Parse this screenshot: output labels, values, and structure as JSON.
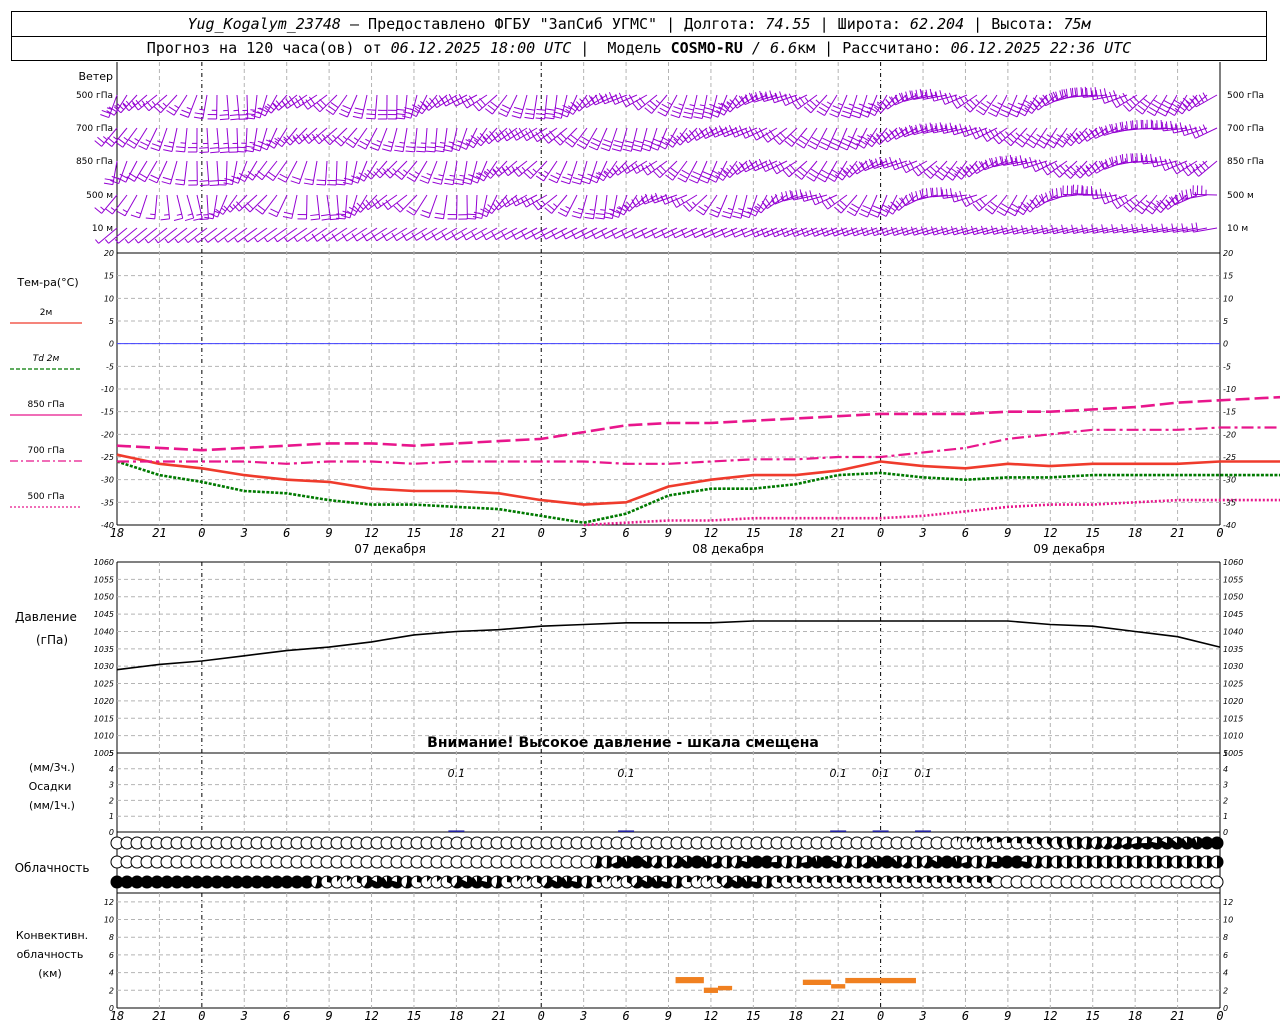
{
  "header": {
    "station": "Yug_Kogalym_23748",
    "provider": " — Предоставлено ФГБУ \"ЗапСиб УГМС\" ",
    "lon_label": " Долгота: ",
    "lon_value": "74.55",
    "lat_label": " Широта: ",
    "lat_value": "62.204",
    "alt_label": " Высота: ",
    "alt_value": "75м",
    "forecast_label": "Прогноз на 120 часа(ов) от ",
    "forecast_start": "06.12.2025 18:00 UTC",
    "model_label": "  Модель ",
    "model_name": "COSMO-RU",
    "model_res": " / 6.6",
    "model_res_unit": "км",
    "calc_label": " Рассчитано: ",
    "calc_time": "06.12.2025 22:36 UTC"
  },
  "wind_panel": {
    "title": "Ветер",
    "levels": [
      "500 гПа",
      "700 гПа",
      "850 гПа",
      "500 м",
      "10  м"
    ]
  },
  "temp_panel": {
    "title": "Тем-ра(°C)",
    "legend": [
      "2м",
      "Td  2м",
      "850 гПа",
      "700 гПа",
      "500 гПа"
    ]
  },
  "pressure_panel": {
    "title": "Давление",
    "unit": "(гПа)",
    "warning": "Внимание! Высокое давление - шкала смещена"
  },
  "precip_panel": {
    "unit3h": "(мм/3ч.)",
    "title": "Осадки",
    "unit1h": "(мм/1ч.)"
  },
  "cloud_panel": {
    "title": "Облачность"
  },
  "conv_panel": {
    "title1": "Конвективн.",
    "title2": "облачность",
    "unit": "(км)"
  },
  "time_axis": {
    "hour_labels": [
      "18",
      "21",
      "0",
      "3",
      "6",
      "9",
      "12",
      "15",
      "18",
      "21",
      "0",
      "3",
      "6",
      "9",
      "12",
      "15",
      "18",
      "21",
      "0",
      "3",
      "6",
      "9",
      "12",
      "15",
      "18",
      "21",
      "0"
    ],
    "day_labels": [
      "07 декабря",
      "08 декабря",
      "09 декабря"
    ]
  },
  "colors": {
    "wind": "#9400d3",
    "t2m": "#ef3b2c",
    "td2m": "#007a00",
    "upper": "#e8168c",
    "zero": "#3f3fff",
    "pressure": "#000000",
    "precip": "#1f1fa0",
    "convective": "#f08020"
  },
  "chart_data": [
    {
      "type": "line",
      "title": "Тем-ра(°C)",
      "x": [
        -6,
        -3,
        0,
        3,
        6,
        9,
        12,
        15,
        18,
        21,
        24,
        27,
        30,
        33,
        36,
        39,
        42,
        45,
        48,
        51,
        54,
        57,
        60,
        63,
        66,
        69,
        72,
        75,
        78,
        81,
        84,
        87,
        90
      ],
      "ylim": [
        -40,
        20
      ],
      "y_ticks": [
        20,
        15,
        10,
        5,
        0,
        -5,
        -10,
        -15,
        -20,
        -25,
        -30,
        -35,
        -40
      ],
      "grid": true,
      "series": [
        {
          "name": "2м",
          "values": [
            -24.5,
            -26.5,
            -27.5,
            -29,
            -30,
            -30.5,
            -32,
            -32.5,
            -32.5,
            -33,
            -34.5,
            -35.5,
            -35,
            -31.5,
            -30,
            -29,
            -29,
            -28,
            -26,
            -27,
            -27.5,
            -26.5,
            -27,
            -26.5,
            -26.5,
            -26.5,
            -26,
            -26,
            -26,
            -26,
            -26,
            -26,
            -25.5
          ]
        },
        {
          "name": "Td  2м",
          "values": [
            -26,
            -29,
            -30.5,
            -32.5,
            -33,
            -34.5,
            -35.5,
            -35.5,
            -36,
            -36.5,
            -38,
            -39.5,
            -37.5,
            -33.5,
            -32,
            -32,
            -31,
            -29,
            -28.5,
            -29.5,
            -30,
            -29.5,
            -29.5,
            -29,
            -29,
            -29,
            -29,
            -29,
            -29,
            -29,
            -29,
            -29,
            -29
          ]
        },
        {
          "name": "850 гПа",
          "values": [
            -22.5,
            -23,
            -23.5,
            -23,
            -22.5,
            -22,
            -22,
            -22.5,
            -22,
            -21.5,
            -21,
            -19.5,
            -18,
            -17.5,
            -17.5,
            -17,
            -16.5,
            -16,
            -15.5,
            -15.5,
            -15.5,
            -15,
            -15,
            -14.5,
            -14,
            -13,
            -12.5,
            -12,
            -11.5,
            -11.5,
            -11.5,
            -11.5,
            -11.5
          ]
        },
        {
          "name": "700 гПа",
          "values": [
            -26,
            -26,
            -26,
            -26,
            -26.5,
            -26,
            -26,
            -26.5,
            -26,
            -26,
            -26,
            -26,
            -26.5,
            -26.5,
            -26,
            -25.5,
            -25.5,
            -25,
            -25,
            -24,
            -23,
            -21,
            -20,
            -19,
            -19,
            -19,
            -18.5,
            -18.5,
            -18.5,
            -18.5,
            -18.5,
            -18.5,
            -18.5
          ]
        },
        {
          "name": "500 гПа",
          "values": [
            null,
            null,
            null,
            null,
            null,
            null,
            null,
            null,
            null,
            null,
            null,
            -40,
            -39.5,
            -39,
            -39,
            -38.5,
            -38.5,
            -38.5,
            -38.5,
            -38,
            -37,
            -36,
            -35.5,
            -35.5,
            -35,
            -34.5,
            -34.5,
            -34.5,
            -34.5,
            -34.5,
            -34.5,
            -34.5,
            -34.5
          ]
        }
      ]
    },
    {
      "type": "line",
      "title": "Давление",
      "ylabel": "(гПа)",
      "x": [
        -6,
        -3,
        0,
        3,
        6,
        9,
        12,
        15,
        18,
        21,
        24,
        27,
        30,
        33,
        36,
        39,
        42,
        45,
        48,
        51,
        54,
        57,
        60,
        63,
        66,
        69,
        72
      ],
      "ylim": [
        1005,
        1060
      ],
      "y_ticks": [
        1060,
        1055,
        1050,
        1045,
        1040,
        1035,
        1030,
        1025,
        1020,
        1015,
        1010,
        1005
      ],
      "series": [
        {
          "name": "",
          "values": [
            1029,
            1030.5,
            1031.5,
            1033,
            1034.5,
            1035.5,
            1037,
            1039,
            1040,
            1040.5,
            1041.5,
            1042,
            1042.5,
            1042.5,
            1042.5,
            1043,
            1043,
            1043,
            1043,
            1043,
            1043,
            1043,
            1042,
            1041.5,
            1040,
            1038.5,
            1035.5
          ]
        }
      ]
    },
    {
      "type": "bar",
      "title": "Осадки",
      "ylim": [
        0,
        5
      ],
      "y_ticks": [
        5,
        4,
        3,
        2,
        1,
        0
      ],
      "annotations": [
        {
          "x": 18,
          "text": "0.1"
        },
        {
          "x": 30,
          "text": "0.1"
        },
        {
          "x": 45,
          "text": "0.1"
        },
        {
          "x": 48,
          "text": "0.1"
        },
        {
          "x": 51,
          "text": "0.1"
        }
      ],
      "values": [
        {
          "x": 18,
          "y": 0.1
        },
        {
          "x": 30,
          "y": 0.1
        },
        {
          "x": 45,
          "y": 0.1
        },
        {
          "x": 48,
          "y": 0.1
        },
        {
          "x": 51,
          "y": 0.1
        }
      ]
    },
    {
      "type": "bar",
      "title": "Конвективн. облачность",
      "ylabel": "(км)",
      "ylim": [
        0,
        13
      ],
      "y_ticks": [
        12,
        10,
        8,
        6,
        4,
        2,
        0
      ],
      "values": [
        {
          "x_start": 33.5,
          "x_end": 35.5,
          "base": 2.8,
          "top": 3.5
        },
        {
          "x_start": 35.5,
          "x_end": 36.5,
          "base": 1.7,
          "top": 2.3
        },
        {
          "x_start": 36.5,
          "x_end": 37.5,
          "base": 2.0,
          "top": 2.5
        },
        {
          "x_start": 42.5,
          "x_end": 44.5,
          "base": 2.6,
          "top": 3.2
        },
        {
          "x_start": 44.5,
          "x_end": 45.5,
          "base": 2.2,
          "top": 2.7
        },
        {
          "x_start": 45.5,
          "x_end": 48.0,
          "base": 2.8,
          "top": 3.4
        },
        {
          "x_start": 48.0,
          "x_end": 50.5,
          "base": 2.8,
          "top": 3.4
        }
      ]
    }
  ]
}
